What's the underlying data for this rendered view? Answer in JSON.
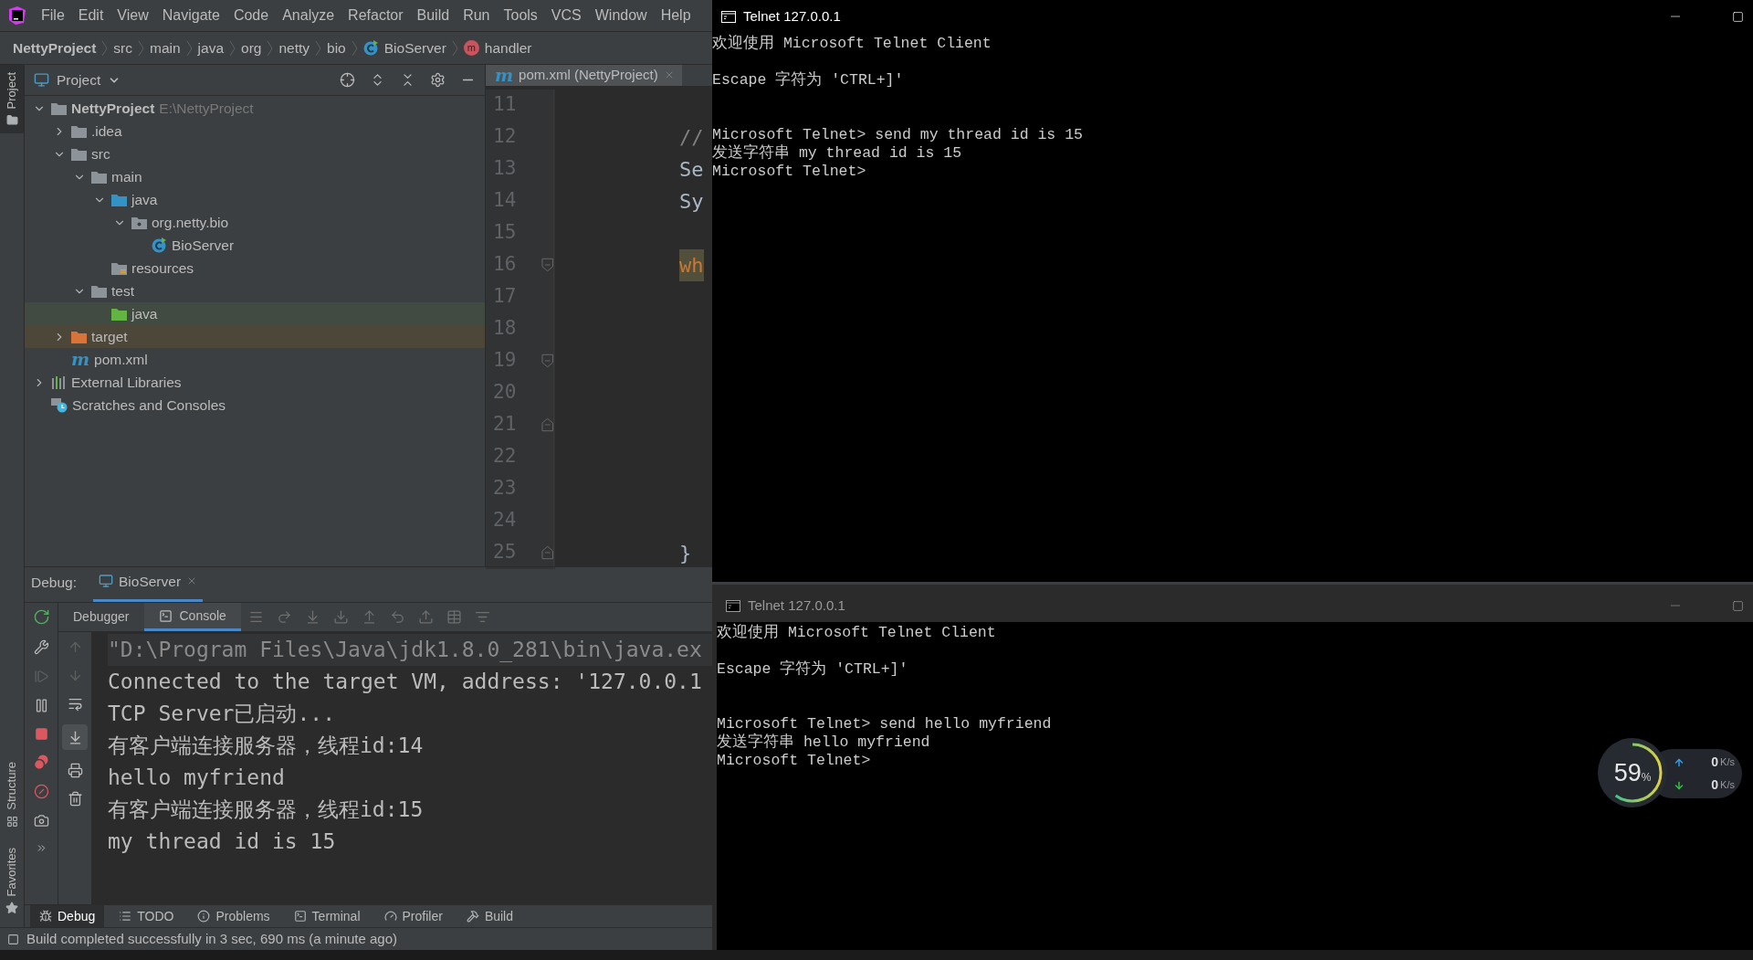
{
  "ide": {
    "menu": [
      "File",
      "Edit",
      "View",
      "Navigate",
      "Code",
      "Analyze",
      "Refactor",
      "Build",
      "Run",
      "Tools",
      "VCS",
      "Window",
      "Help"
    ],
    "breadcrumb": [
      {
        "label": "NettyProject",
        "kind": "project"
      },
      {
        "label": "src",
        "kind": "folder"
      },
      {
        "label": "main",
        "kind": "folder"
      },
      {
        "label": "java",
        "kind": "folder"
      },
      {
        "label": "org",
        "kind": "folder"
      },
      {
        "label": "netty",
        "kind": "folder"
      },
      {
        "label": "bio",
        "kind": "folder"
      },
      {
        "label": "BioServer",
        "kind": "class"
      },
      {
        "label": "handler",
        "kind": "method",
        "icon_text": "m"
      }
    ],
    "side_tabs": [
      {
        "label": "Project",
        "selected": true,
        "kind": "top"
      },
      {
        "label": "Structure",
        "selected": false,
        "kind": "bottom"
      },
      {
        "label": "Favorites",
        "selected": false,
        "kind": "bottom"
      }
    ],
    "project_panel": {
      "title": "Project",
      "tree": [
        {
          "label": "NettyProject",
          "kind": "module",
          "path": "E:\\NettyProject",
          "expanded": true,
          "children": [
            {
              "label": ".idea",
              "kind": "folder",
              "expanded": false
            },
            {
              "label": "src",
              "kind": "folder",
              "expanded": true,
              "children": [
                {
                  "label": "main",
                  "kind": "folder",
                  "expanded": true,
                  "children": [
                    {
                      "label": "java",
                      "kind": "source",
                      "expanded": true,
                      "children": [
                        {
                          "label": "org.netty.bio",
                          "kind": "package",
                          "expanded": true,
                          "children": [
                            {
                              "label": "BioServer",
                              "kind": "class"
                            }
                          ]
                        }
                      ]
                    },
                    {
                      "label": "resources",
                      "kind": "resources"
                    }
                  ]
                },
                {
                  "label": "test",
                  "kind": "folder",
                  "expanded": true,
                  "children": [
                    {
                      "label": "java",
                      "kind": "test"
                    }
                  ]
                }
              ]
            },
            {
              "label": "target",
              "kind": "excluded",
              "expanded": false
            },
            {
              "label": "pom.xml",
              "kind": "maven",
              "icon_text": "m"
            }
          ]
        },
        {
          "label": "External Libraries",
          "kind": "libraries",
          "expanded": false
        },
        {
          "label": "Scratches and Consoles",
          "kind": "scratches"
        }
      ]
    },
    "editor": {
      "tab": {
        "label": "pom.xml (NettyProject)",
        "icon_text": "m"
      },
      "lines": [
        {
          "number": "11"
        },
        {
          "number": "12",
          "code": "//",
          "kind": "comment"
        },
        {
          "number": "13",
          "code": "Se",
          "kind": "plain"
        },
        {
          "number": "14",
          "code": "Sy",
          "kind": "plain"
        },
        {
          "number": "15"
        },
        {
          "number": "16",
          "code": "wh",
          "kind": "keyword",
          "fold_start": true
        },
        {
          "number": "17"
        },
        {
          "number": "18"
        },
        {
          "number": "19",
          "fold_start": true
        },
        {
          "number": "20"
        },
        {
          "number": "21",
          "fold_end": true
        },
        {
          "number": "22"
        },
        {
          "number": "23"
        },
        {
          "number": "24"
        },
        {
          "number": "25",
          "code": "}",
          "kind": "plain",
          "fold_end": true
        }
      ]
    },
    "debug": {
      "label": "Debug:",
      "session": "BioServer",
      "tabs": [
        {
          "label": "Debugger",
          "selected": false
        },
        {
          "label": "Console",
          "selected": true
        }
      ],
      "console": [
        {
          "text": "\"D:\\Program Files\\Java\\jdk1.8.0_281\\bin\\java.ex",
          "kind": "command"
        },
        {
          "text": "Connected to the target VM, address: '127.0.0.1",
          "kind": "output"
        },
        {
          "text": "TCP Server已启动...",
          "kind": "output"
        },
        {
          "text": "有客户端连接服务器，线程id:14",
          "kind": "output"
        },
        {
          "text": "hello myfriend",
          "kind": "output"
        },
        {
          "text": "有客户端连接服务器，线程id:15",
          "kind": "output"
        },
        {
          "text": "my thread id is 15",
          "kind": "output"
        }
      ]
    },
    "tool_tabs": [
      {
        "label": "Debug",
        "kind": "debug",
        "selected": true
      },
      {
        "label": "TODO",
        "kind": "todo",
        "selected": false
      },
      {
        "label": "Problems",
        "kind": "problems",
        "selected": false
      },
      {
        "label": "Terminal",
        "kind": "terminal",
        "selected": false
      },
      {
        "label": "Profiler",
        "kind": "profiler",
        "selected": false
      },
      {
        "label": "Build",
        "kind": "build",
        "selected": false
      }
    ],
    "status": "Build completed successfully in 3 sec, 690 ms (a minute ago)"
  },
  "telnet_windows": [
    {
      "title": "Telnet 127.0.0.1",
      "active": true,
      "blocks": [
        [
          "欢迎使用 Microsoft Telnet Client"
        ],
        [
          "Escape 字符为 'CTRL+]'"
        ],
        [
          "Microsoft Telnet> send my thread id is 15",
          "发送字符串 my thread id is 15",
          "Microsoft Telnet>"
        ]
      ]
    },
    {
      "title": "Telnet 127.0.0.1",
      "active": false,
      "blocks": [
        [
          "欢迎使用 Microsoft Telnet Client"
        ],
        [
          "Escape 字符为 'CTRL+]'"
        ],
        [
          "Microsoft Telnet> send hello myfriend",
          "发送字符串 hello myfriend",
          "Microsoft Telnet>"
        ]
      ]
    }
  ],
  "net_widget": {
    "percent": "59",
    "percent_unit": "%",
    "rates": [
      {
        "kind": "upload",
        "value": "0",
        "unit": "K/s"
      },
      {
        "kind": "download",
        "value": "0",
        "unit": "K/s"
      }
    ]
  }
}
